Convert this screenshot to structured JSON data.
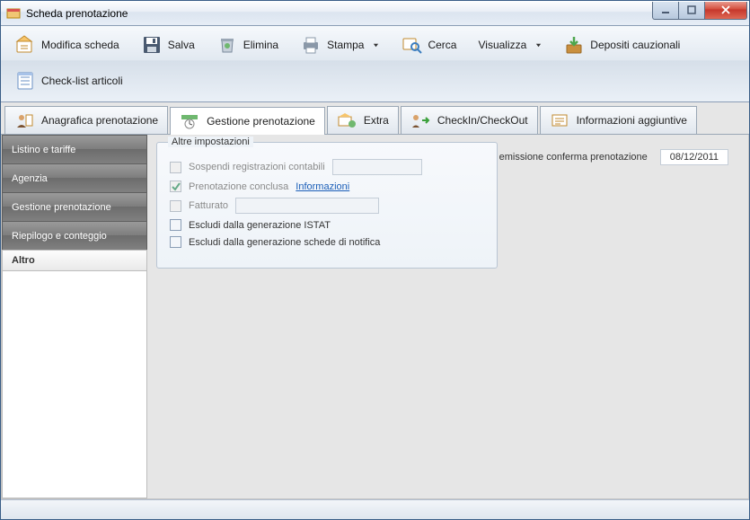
{
  "window": {
    "title": "Scheda prenotazione"
  },
  "toolbar": {
    "modify": "Modifica scheda",
    "save": "Salva",
    "delete": "Elimina",
    "print": "Stampa",
    "search": "Cerca",
    "view": "Visualizza",
    "deposits": "Depositi cauzionali",
    "checklist": "Check-list articoli"
  },
  "tabs": {
    "anagrafica": "Anagrafica prenotazione",
    "gestione": "Gestione prenotazione",
    "extra": "Extra",
    "checkin": "CheckIn/CheckOut",
    "info": "Informazioni aggiuntive"
  },
  "sidebar": {
    "items": [
      {
        "label": "Listino e tariffe"
      },
      {
        "label": "Agenzia"
      },
      {
        "label": "Gestione prenotazione"
      },
      {
        "label": "Riepilogo e conteggio"
      }
    ],
    "active": "Altro"
  },
  "group": {
    "legend": "Altre impostazioni",
    "sospendi": "Sospendi registrazioni contabili",
    "conclusa": "Prenotazione conclusa",
    "info_link": "Informazioni",
    "fatturato": "Fatturato",
    "escludi_istat": "Escludi dalla generazione ISTAT",
    "escludi_notifica": "Escludi dalla generazione schede di notifica"
  },
  "emission": {
    "label": "Data emissione conferma prenotazione",
    "value": "08/12/2011"
  }
}
